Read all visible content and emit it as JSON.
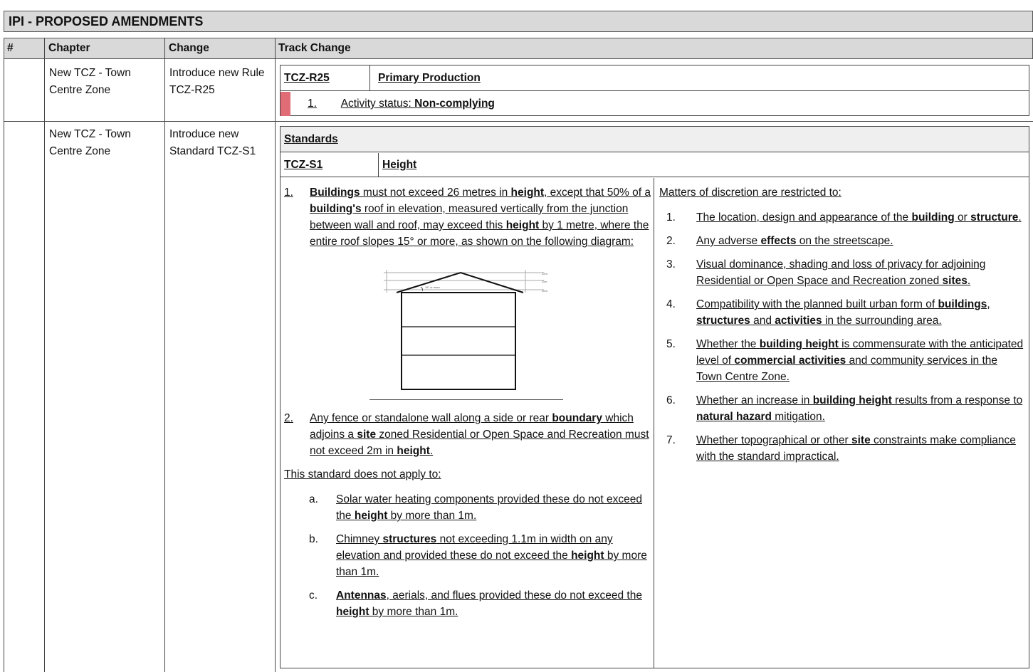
{
  "title": "IPI - PROPOSED AMENDMENTS",
  "headers": {
    "num": "#",
    "chapter": "Chapter",
    "change": "Change",
    "track": "Track Change"
  },
  "row1": {
    "chapter": "New TCZ - Town Centre Zone",
    "change": "Introduce new Rule TCZ-R25",
    "rule_code": "TCZ-R25",
    "rule_name": "Primary Production",
    "status_num": "1.",
    "status_label": "Activity status: ",
    "status_value": "Non-complying"
  },
  "row2": {
    "chapter": "New TCZ - Town Centre Zone",
    "change": "Introduce new Standard TCZ-S1",
    "section": "Standards",
    "std_code": "TCZ-S1",
    "std_name": "Height",
    "left": {
      "p1_num": "1.",
      "p1": [
        {
          "t": "Buildings",
          "b": true
        },
        {
          "t": " must not exceed 26 metres in ",
          "b": false
        },
        {
          "t": "height",
          "b": true
        },
        {
          "t": ", except that 50% of a ",
          "b": false
        },
        {
          "t": "building's",
          "b": true
        },
        {
          "t": " roof in elevation, measured vertically from the junction between wall and roof, may exceed this ",
          "b": false
        },
        {
          "t": "height",
          "b": true
        },
        {
          "t": " by 1 metre, where the entire roof slopes 15° or more, as shown on the following diagram:",
          "b": false
        }
      ],
      "diagram": {
        "label_slope": "15° or more",
        "label_12": "12m",
        "label_11": "11m",
        "label_10": "10m"
      },
      "p2_num": "2.",
      "p2": [
        {
          "t": "Any fence or standalone wall along a side or rear ",
          "b": false
        },
        {
          "t": "boundary",
          "b": true
        },
        {
          "t": " which adjoins a ",
          "b": false
        },
        {
          "t": "site",
          "b": true
        },
        {
          "t": " zoned Residential or Open Space and Recreation must not exceed 2m in ",
          "b": false
        },
        {
          "t": "height",
          "b": true
        },
        {
          "t": ".",
          "b": false
        }
      ],
      "exempt_intro": "This standard does not apply to:",
      "exempt": [
        {
          "n": "a.",
          "parts": [
            {
              "t": "Solar water heating components provided these do not exceed the ",
              "b": false
            },
            {
              "t": "height",
              "b": true
            },
            {
              "t": " by more than 1m.",
              "b": false
            }
          ]
        },
        {
          "n": "b.",
          "parts": [
            {
              "t": "Chimney ",
              "b": false
            },
            {
              "t": "structures",
              "b": true
            },
            {
              "t": " not exceeding 1.1m in width on any elevation and provided these do not exceed the ",
              "b": false
            },
            {
              "t": "height",
              "b": true
            },
            {
              "t": " by more than 1m.",
              "b": false
            }
          ]
        },
        {
          "n": "c.",
          "parts": [
            {
              "t": "Antennas",
              "b": true
            },
            {
              "t": ", aerials, and flues provided these do not exceed the ",
              "b": false
            },
            {
              "t": "height",
              "b": true
            },
            {
              "t": " by more than 1m.",
              "b": false
            }
          ]
        }
      ]
    },
    "right": {
      "intro": "Matters of discretion are restricted to:",
      "items": [
        {
          "n": "1.",
          "parts": [
            {
              "t": "The location, design and appearance of the ",
              "b": false
            },
            {
              "t": "building",
              "b": true
            },
            {
              "t": " or ",
              "b": false
            },
            {
              "t": "structure",
              "b": true
            },
            {
              "t": ".",
              "b": false
            }
          ]
        },
        {
          "n": "2.",
          "parts": [
            {
              "t": "Any adverse ",
              "b": false
            },
            {
              "t": "effects",
              "b": true
            },
            {
              "t": " on the streetscape.",
              "b": false
            }
          ]
        },
        {
          "n": "3.",
          "parts": [
            {
              "t": "Visual dominance, shading and loss of privacy for adjoining Residential or Open Space and Recreation zoned ",
              "b": false
            },
            {
              "t": "sites",
              "b": true
            },
            {
              "t": ".",
              "b": false
            }
          ]
        },
        {
          "n": "4.",
          "parts": [
            {
              "t": "Compatibility with the planned built urban form of ",
              "b": false
            },
            {
              "t": "buildings",
              "b": true
            },
            {
              "t": ", ",
              "b": false
            },
            {
              "t": "structures",
              "b": true
            },
            {
              "t": " and ",
              "b": false
            },
            {
              "t": "activities",
              "b": true
            },
            {
              "t": " in the surrounding area.",
              "b": false
            }
          ]
        },
        {
          "n": "5.",
          "parts": [
            {
              "t": "Whether the ",
              "b": false
            },
            {
              "t": "building height",
              "b": true
            },
            {
              "t": " is commensurate with the anticipated level of ",
              "b": false
            },
            {
              "t": "commercial activities",
              "b": true
            },
            {
              "t": " and community services in the Town Centre Zone.",
              "b": false
            }
          ]
        },
        {
          "n": "6.",
          "parts": [
            {
              "t": "Whether an increase in ",
              "b": false
            },
            {
              "t": "building height",
              "b": true
            },
            {
              "t": " results from a response to ",
              "b": false
            },
            {
              "t": "natural hazard",
              "b": true
            },
            {
              "t": " mitigation.",
              "b": false
            }
          ]
        },
        {
          "n": "7.",
          "parts": [
            {
              "t": "Whether topographical or other ",
              "b": false
            },
            {
              "t": "site",
              "b": true
            },
            {
              "t": " constraints make compliance with the standard impractical.",
              "b": false
            }
          ]
        }
      ]
    }
  },
  "colors": {
    "header_bg": "#d9d9d9",
    "status_marker": "#e06c75",
    "border": "#444444"
  }
}
